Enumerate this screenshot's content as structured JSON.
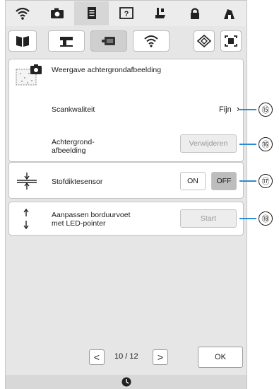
{
  "top_tabs": [
    {
      "icon": "wifi-icon"
    },
    {
      "icon": "camera-icon"
    },
    {
      "icon": "document-icon"
    },
    {
      "icon": "help-icon"
    },
    {
      "icon": "sewing-foot-icon"
    },
    {
      "icon": "lock-icon"
    },
    {
      "icon": "home-icon"
    }
  ],
  "sub_buttons": [
    {
      "icon": "book-icon"
    },
    {
      "icon": "sewing-machine-icon"
    },
    {
      "icon": "embroidery-frame-icon"
    },
    {
      "icon": "wifi-icon"
    },
    {
      "icon": "diamond-icon"
    },
    {
      "icon": "scan-icon"
    }
  ],
  "background": {
    "title": "Weergave achtergrondafbeelding",
    "scan_quality_label": "Scankwaliteit",
    "scan_quality_value": "Fijn",
    "background_image_label": "Achtergrond-\nafbeelding",
    "remove_button": "Verwijderen"
  },
  "fabric_sensor": {
    "label": "Stofdiktesensor",
    "on": "ON",
    "off": "OFF",
    "selected": "OFF"
  },
  "foot_adjust": {
    "label": "Aanpassen borduurvoet\nmet LED-pointer",
    "start_button": "Start"
  },
  "footer": {
    "prev": "<",
    "page_indicator": "10 / 12",
    "next": ">",
    "ok": "OK"
  },
  "callouts": [
    "⑮",
    "⑯",
    "⑰",
    "⑱"
  ],
  "colors": {
    "accent": "#2a8ad6",
    "screen_bg": "#e6e6e6",
    "selected_button": "#bdbdbd"
  }
}
